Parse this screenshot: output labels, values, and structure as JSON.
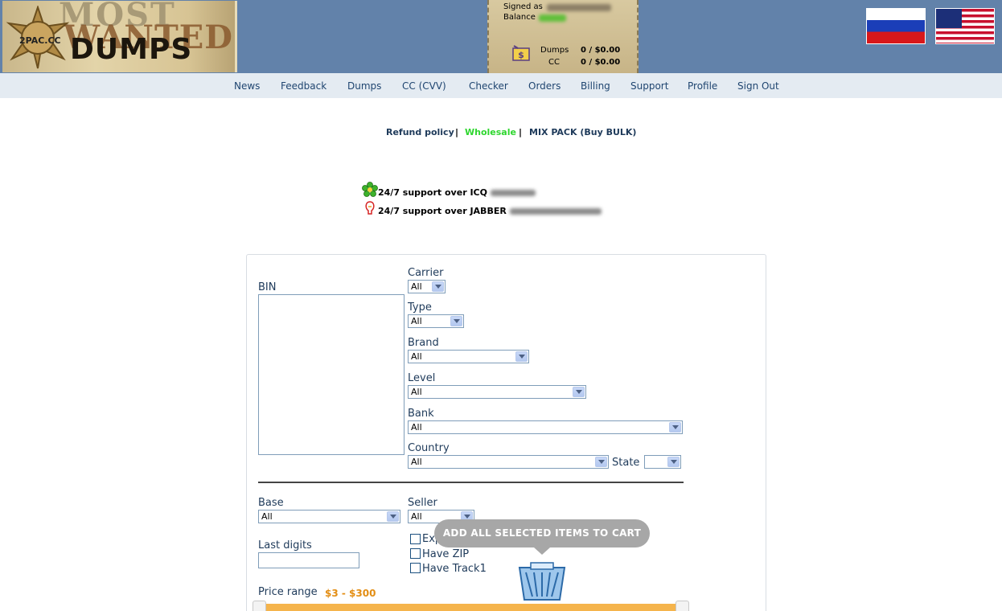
{
  "header": {
    "logo": {
      "badge_text": "2PAC.CC",
      "word_most": "MOST",
      "word_wanted": "WANTED",
      "word_dumps": "DUMPS"
    },
    "user": {
      "signed_label": "Signed as",
      "balance_label": "Balance",
      "dumps_label": "Dumps",
      "dumps_value": "0 / $0.00",
      "cc_label": "CC",
      "cc_value": "0 / $0.00"
    },
    "flags": [
      "russian-flag-icon",
      "us-flag-icon"
    ]
  },
  "nav": {
    "items": [
      "News",
      "Feedback",
      "Dumps",
      "CC (CVV)",
      "Checker",
      "Orders",
      "Billing",
      "Support",
      "Profile",
      "Sign Out"
    ]
  },
  "sublinks": {
    "refund": "Refund policy",
    "wholesale": "Wholesale",
    "mixpack": "MIX PACK (Buy BULK)",
    "sep": "|",
    "colors": {
      "link": "#1e3a5a",
      "wholesale": "#2fd62f"
    }
  },
  "support": {
    "icq": "24/7 support over ICQ",
    "jabber": "24/7 support over JABBER"
  },
  "form": {
    "bin_label": "BIN",
    "carrier_label": "Carrier",
    "carrier_value": "All",
    "type_label": "Type",
    "type_value": "All",
    "brand_label": "Brand",
    "brand_value": "All",
    "level_label": "Level",
    "level_value": "All",
    "bank_label": "Bank",
    "bank_value": "All",
    "country_label": "Country",
    "country_value": "All",
    "state_label": "State",
    "state_value": "",
    "base_label": "Base",
    "base_value": "All",
    "seller_label": "Seller",
    "seller_value": "All",
    "last_digits_label": "Last digits",
    "last_digits_value": "",
    "expire_label": "Expire this month",
    "zip_label": "Have ZIP",
    "track1_label": "Have Track1",
    "price_label": "Price range",
    "price_value": "$3 - $300"
  },
  "tooltip": {
    "text": "ADD ALL SELECTED ITEMS TO CART"
  }
}
